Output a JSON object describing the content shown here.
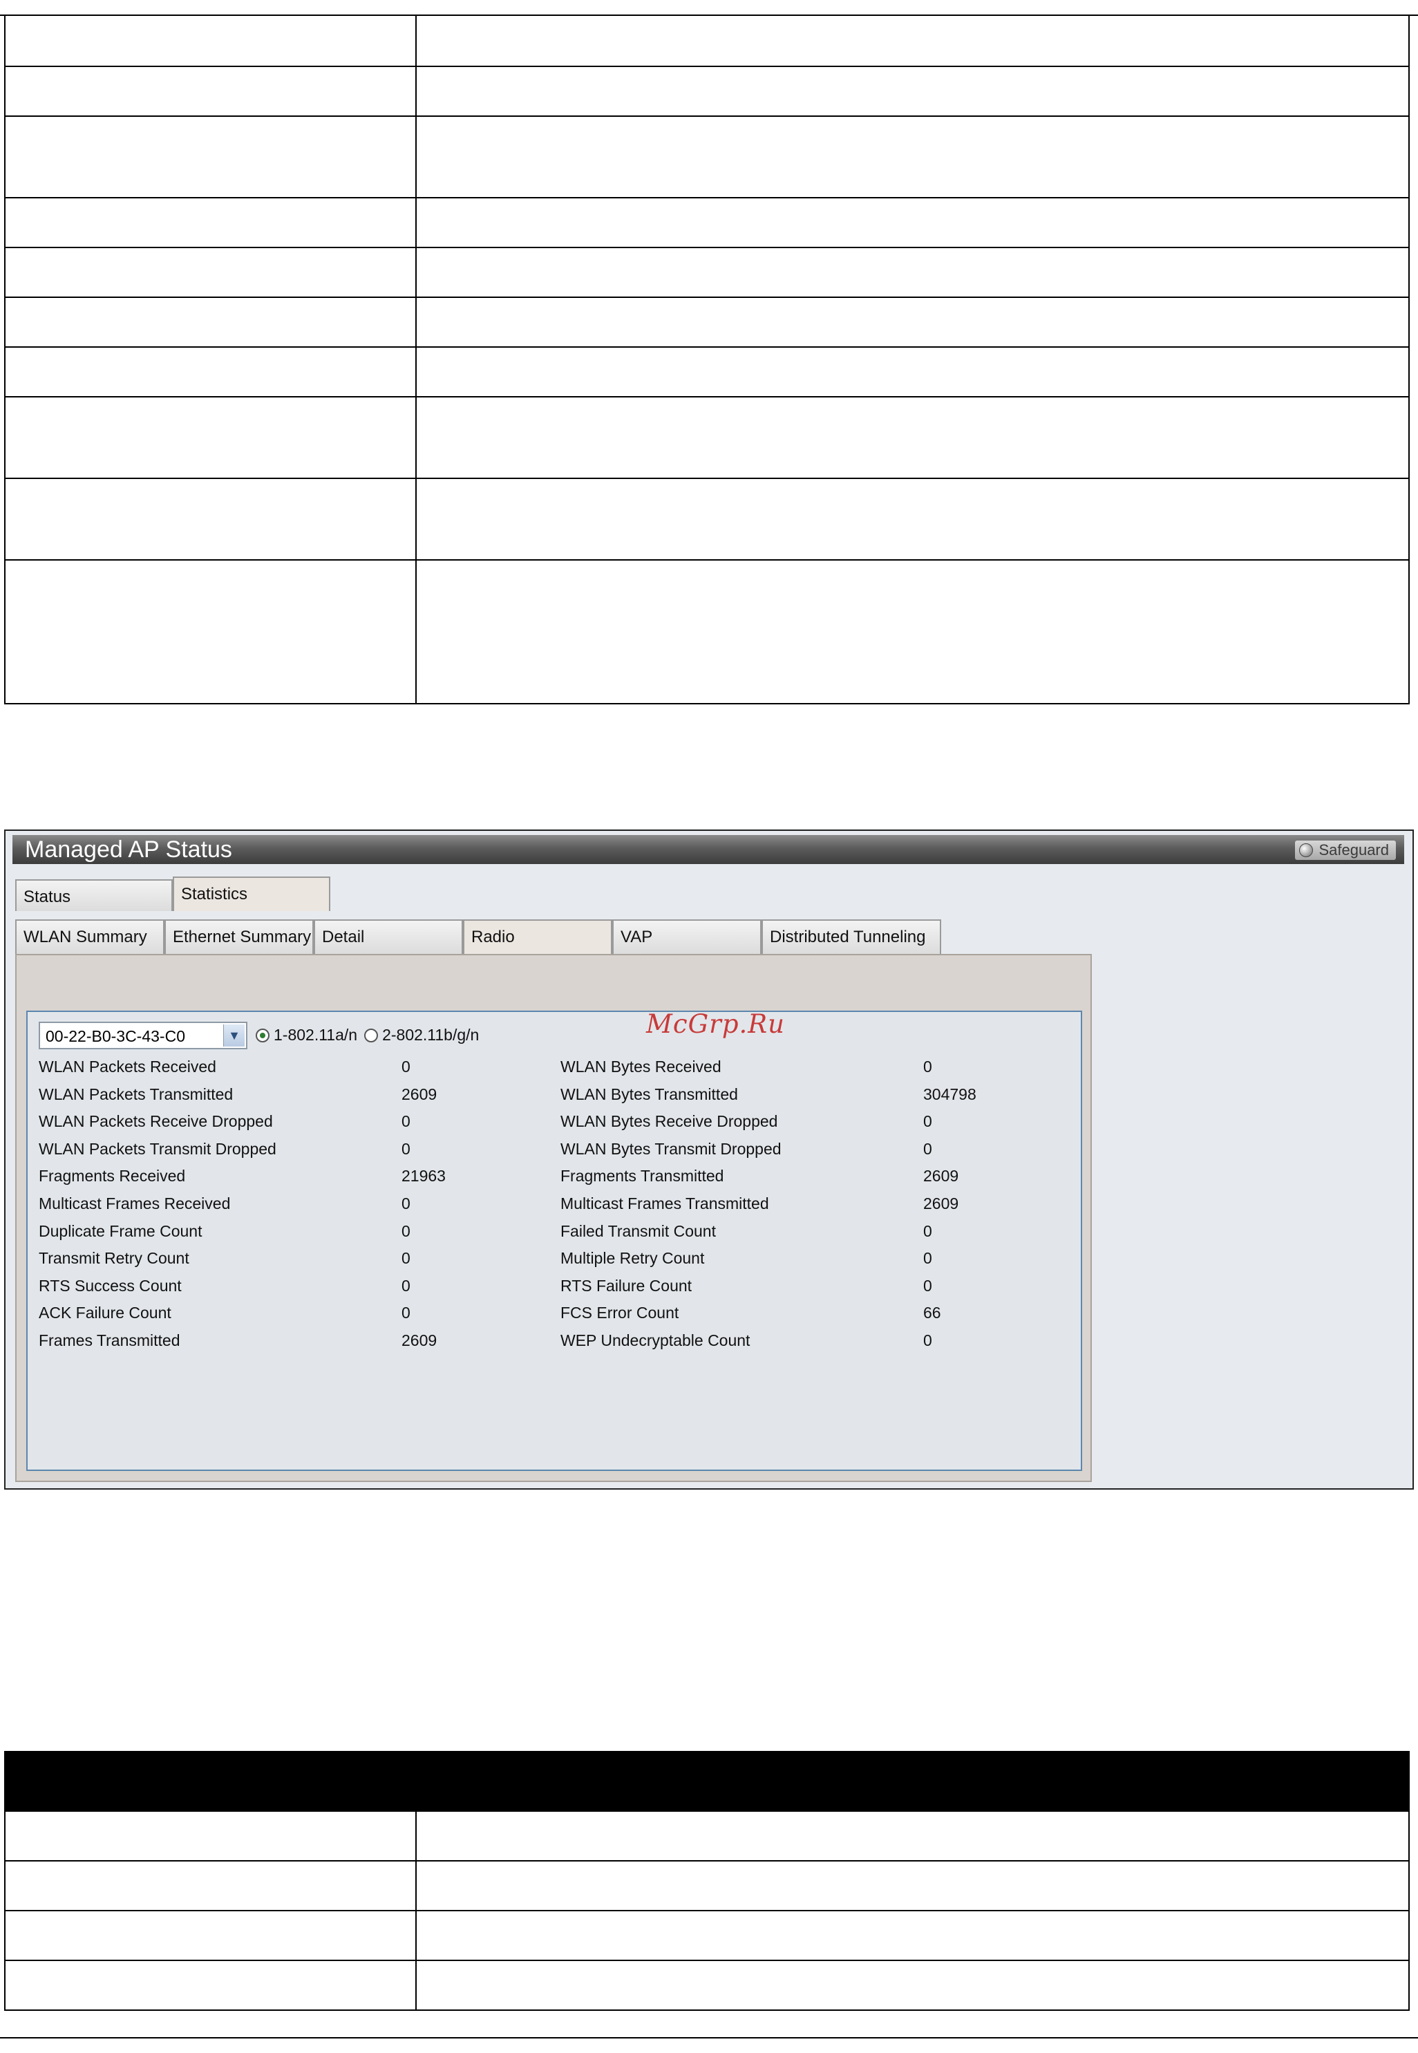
{
  "window": {
    "title": "Managed AP Status",
    "safeguard_label": "Safeguard"
  },
  "tabs": [
    {
      "label": "Status"
    },
    {
      "label": "Statistics"
    }
  ],
  "subtabs": [
    {
      "label": "WLAN Summary"
    },
    {
      "label": "Ethernet Summary"
    },
    {
      "label": "Detail"
    },
    {
      "label": "Radio"
    },
    {
      "label": "VAP"
    },
    {
      "label": "Distributed Tunneling"
    }
  ],
  "ap_select": {
    "value": "00-22-B0-3C-43-C0"
  },
  "radios": [
    {
      "label": "1-802.11a/n",
      "selected": true
    },
    {
      "label": "2-802.11b/g/n",
      "selected": false
    }
  ],
  "stats": [
    {
      "left_label": "WLAN Packets Received",
      "left_value": "0",
      "right_label": "WLAN Bytes Received",
      "right_value": "0"
    },
    {
      "left_label": "WLAN Packets Transmitted",
      "left_value": "2609",
      "right_label": "WLAN Bytes Transmitted",
      "right_value": "304798"
    },
    {
      "left_label": "WLAN Packets Receive Dropped",
      "left_value": "0",
      "right_label": "WLAN Bytes Receive Dropped",
      "right_value": "0"
    },
    {
      "left_label": "WLAN Packets Transmit Dropped",
      "left_value": "0",
      "right_label": "WLAN Bytes Transmit Dropped",
      "right_value": "0"
    },
    {
      "left_label": "Fragments Received",
      "left_value": "21963",
      "right_label": "Fragments Transmitted",
      "right_value": "2609"
    },
    {
      "left_label": "Multicast Frames Received",
      "left_value": "0",
      "right_label": "Multicast Frames Transmitted",
      "right_value": "2609"
    },
    {
      "left_label": "Duplicate Frame Count",
      "left_value": "0",
      "right_label": "Failed Transmit Count",
      "right_value": "0"
    },
    {
      "left_label": "Transmit Retry Count",
      "left_value": "0",
      "right_label": "Multiple Retry Count",
      "right_value": "0"
    },
    {
      "left_label": "RTS Success Count",
      "left_value": "0",
      "right_label": "RTS Failure Count",
      "right_value": "0"
    },
    {
      "left_label": "ACK Failure Count",
      "left_value": "0",
      "right_label": "FCS Error Count",
      "right_value": "66"
    },
    {
      "left_label": "Frames Transmitted",
      "left_value": "2609",
      "right_label": "WEP Undecryptable Count",
      "right_value": "0"
    }
  ],
  "watermark": "McGrp.Ru"
}
